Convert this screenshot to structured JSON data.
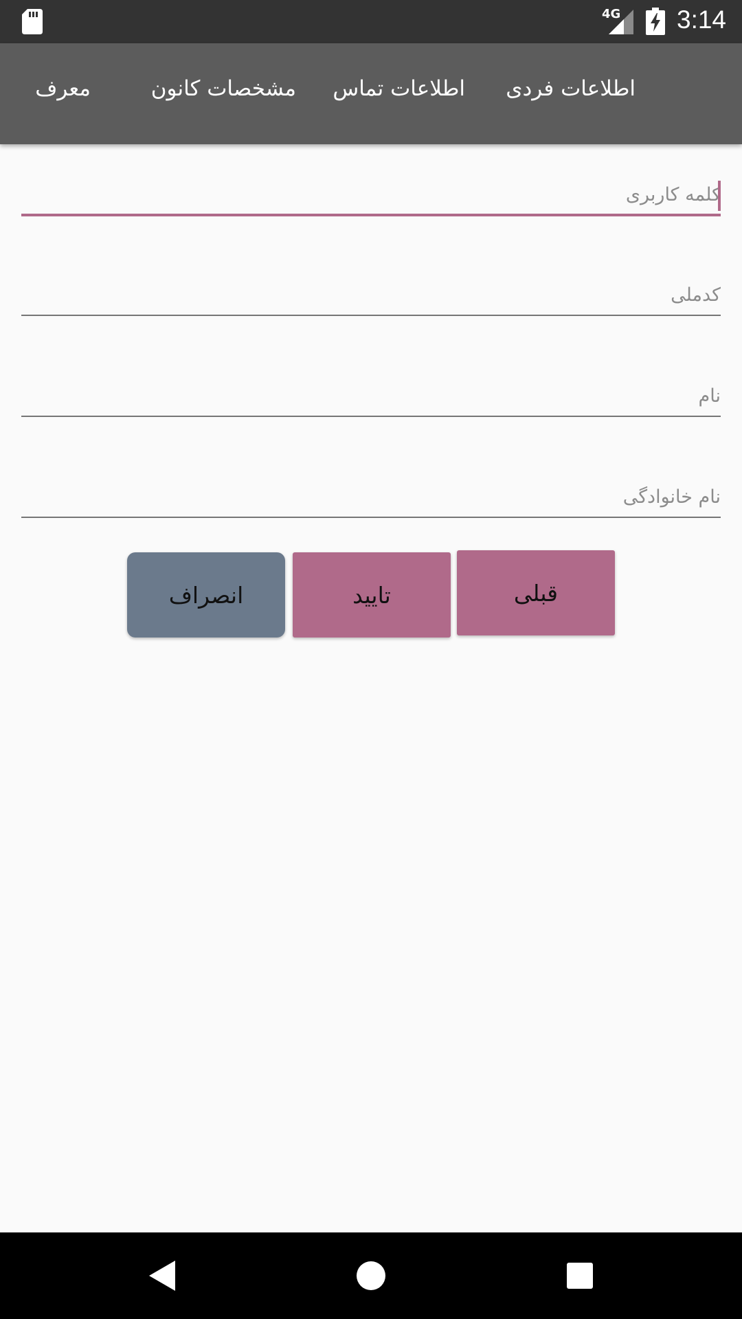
{
  "status_bar": {
    "network": "4G",
    "time": "3:14",
    "icons": [
      "sd-card-icon",
      "signal-icon",
      "battery-charging-icon"
    ]
  },
  "tabs": [
    {
      "label": "اطلاعات فردی"
    },
    {
      "label": "اطلاعات تماس"
    },
    {
      "label": "مشخصات کانون"
    },
    {
      "label": "معرف"
    }
  ],
  "form": {
    "username": {
      "placeholder": "کلمه کاربری",
      "value": ""
    },
    "national_code": {
      "placeholder": "کدملی",
      "value": ""
    },
    "first_name": {
      "placeholder": "نام",
      "value": ""
    },
    "last_name": {
      "placeholder": "نام خانوادگی",
      "value": ""
    }
  },
  "buttons": {
    "cancel": "انصراف",
    "confirm": "تایید",
    "previous": "قبلی"
  },
  "nav": {
    "icons": [
      "back-icon",
      "home-icon",
      "recents-icon"
    ]
  },
  "colors": {
    "accent": "#b06a8a",
    "cancel_button": "#6b7a8c",
    "tab_bar": "#5c5c5c",
    "status_bar": "#333333"
  }
}
